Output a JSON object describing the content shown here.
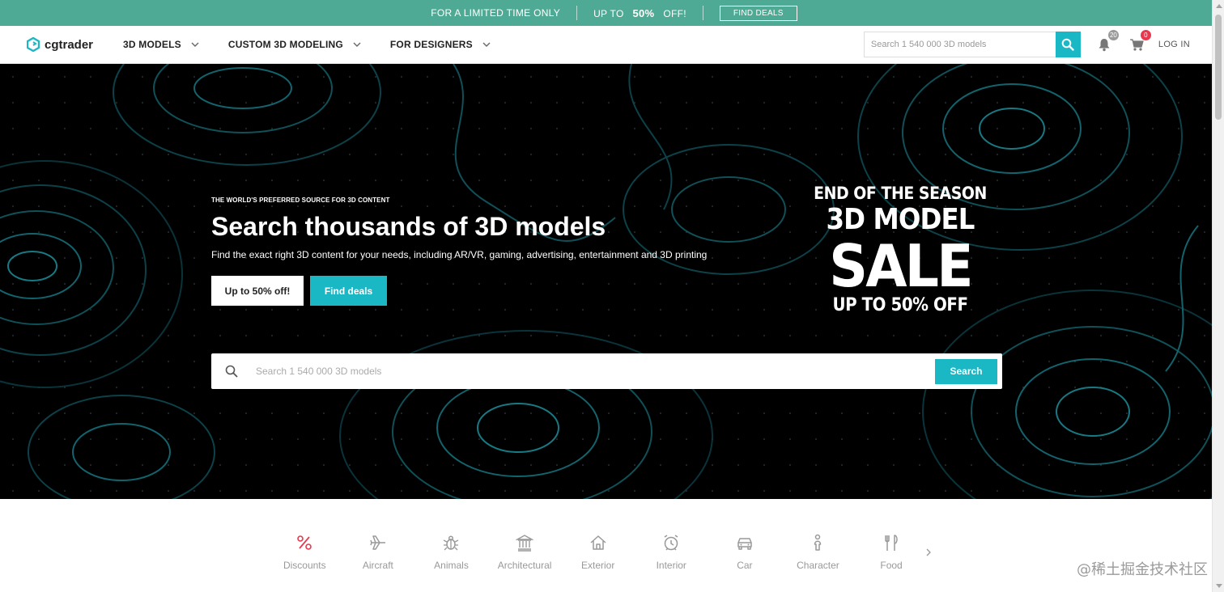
{
  "promo": {
    "limited": "FOR A LIMITED TIME ONLY",
    "up_to": "UP TO",
    "percent": "50%",
    "off": "OFF!",
    "button": "FIND DEALS",
    "bg_color": "#4eaa95"
  },
  "nav": {
    "logo_text": "cgtrader",
    "menu": [
      {
        "label": "3D MODELS"
      },
      {
        "label": "CUSTOM 3D MODELING"
      },
      {
        "label": "FOR DESIGNERS"
      }
    ],
    "search_placeholder": "Search 1 540 000 3D models",
    "notifications_count": "20",
    "cart_count": "0",
    "login": "LOG IN",
    "accent": "#1ab8c5"
  },
  "hero": {
    "eyebrow": "THE WORLD'S PREFERRED SOURCE FOR 3D CONTENT",
    "title": "Search thousands of 3D models",
    "subtitle": "Find the exact right 3D content for your needs, including AR/VR, gaming, advertising, entertainment and 3D printing",
    "btn_discount": "Up to 50% off!",
    "btn_deals": "Find deals",
    "sale": {
      "line1": "END OF THE SEASON",
      "line2": "3D MODEL",
      "line3": "SALE",
      "line4": "UP TO 50% OFF"
    },
    "search_placeholder": "Search 1 540 000 3D models",
    "search_button": "Search"
  },
  "categories": [
    {
      "label": "Discounts",
      "icon": "percent-icon"
    },
    {
      "label": "Aircraft",
      "icon": "airplane-icon"
    },
    {
      "label": "Animals",
      "icon": "beetle-icon"
    },
    {
      "label": "Architectural",
      "icon": "columns-building-icon"
    },
    {
      "label": "Exterior",
      "icon": "house-icon"
    },
    {
      "label": "Interior",
      "icon": "clock-icon"
    },
    {
      "label": "Car",
      "icon": "car-icon"
    },
    {
      "label": "Character",
      "icon": "person-icon"
    },
    {
      "label": "Food",
      "icon": "utensils-icon"
    }
  ],
  "watermark": "@稀土掘金技术社区"
}
